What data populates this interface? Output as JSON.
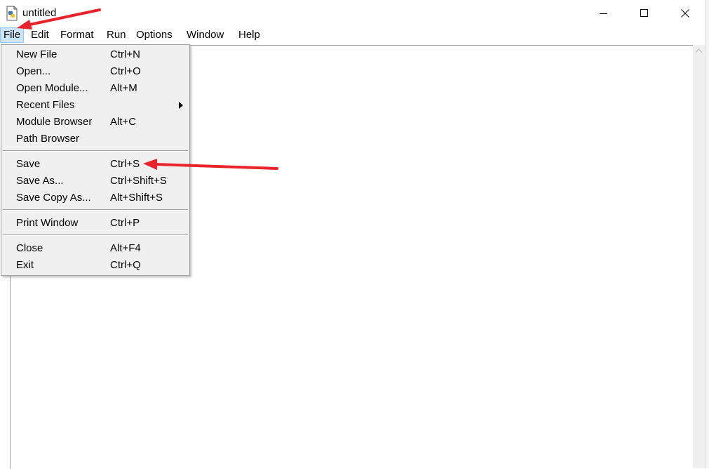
{
  "window": {
    "title": "untitled",
    "icon": "python-idle-icon",
    "controls": [
      "minimize-icon",
      "maximize-icon",
      "close-icon"
    ]
  },
  "menubar": {
    "items": [
      "File",
      "Edit",
      "Format",
      "Run",
      "Options",
      "Window",
      "Help"
    ],
    "active": "File"
  },
  "file_menu": {
    "groups": [
      [
        {
          "label": "New File",
          "accel": "Ctrl+N"
        },
        {
          "label": "Open...",
          "accel": "Ctrl+O"
        },
        {
          "label": "Open Module...",
          "accel": "Alt+M"
        },
        {
          "label": "Recent Files",
          "accel": ""
        },
        {
          "label": "Module Browser",
          "accel": "Alt+C"
        },
        {
          "label": "Path Browser",
          "accel": ""
        }
      ],
      [
        {
          "label": "Save",
          "accel": "Ctrl+S"
        },
        {
          "label": "Save As...",
          "accel": "Ctrl+Shift+S"
        },
        {
          "label": "Save Copy As...",
          "accel": "Alt+Shift+S"
        }
      ],
      [
        {
          "label": "Print Window",
          "accel": "Ctrl+P"
        }
      ],
      [
        {
          "label": "Close",
          "accel": "Alt+F4"
        },
        {
          "label": "Exit",
          "accel": "Ctrl+Q"
        }
      ]
    ]
  },
  "colors": {
    "annotation_arrow": "#e8242a",
    "menu_background": "#f0f0f0",
    "active_menu_highlight": "#cce4f7"
  }
}
